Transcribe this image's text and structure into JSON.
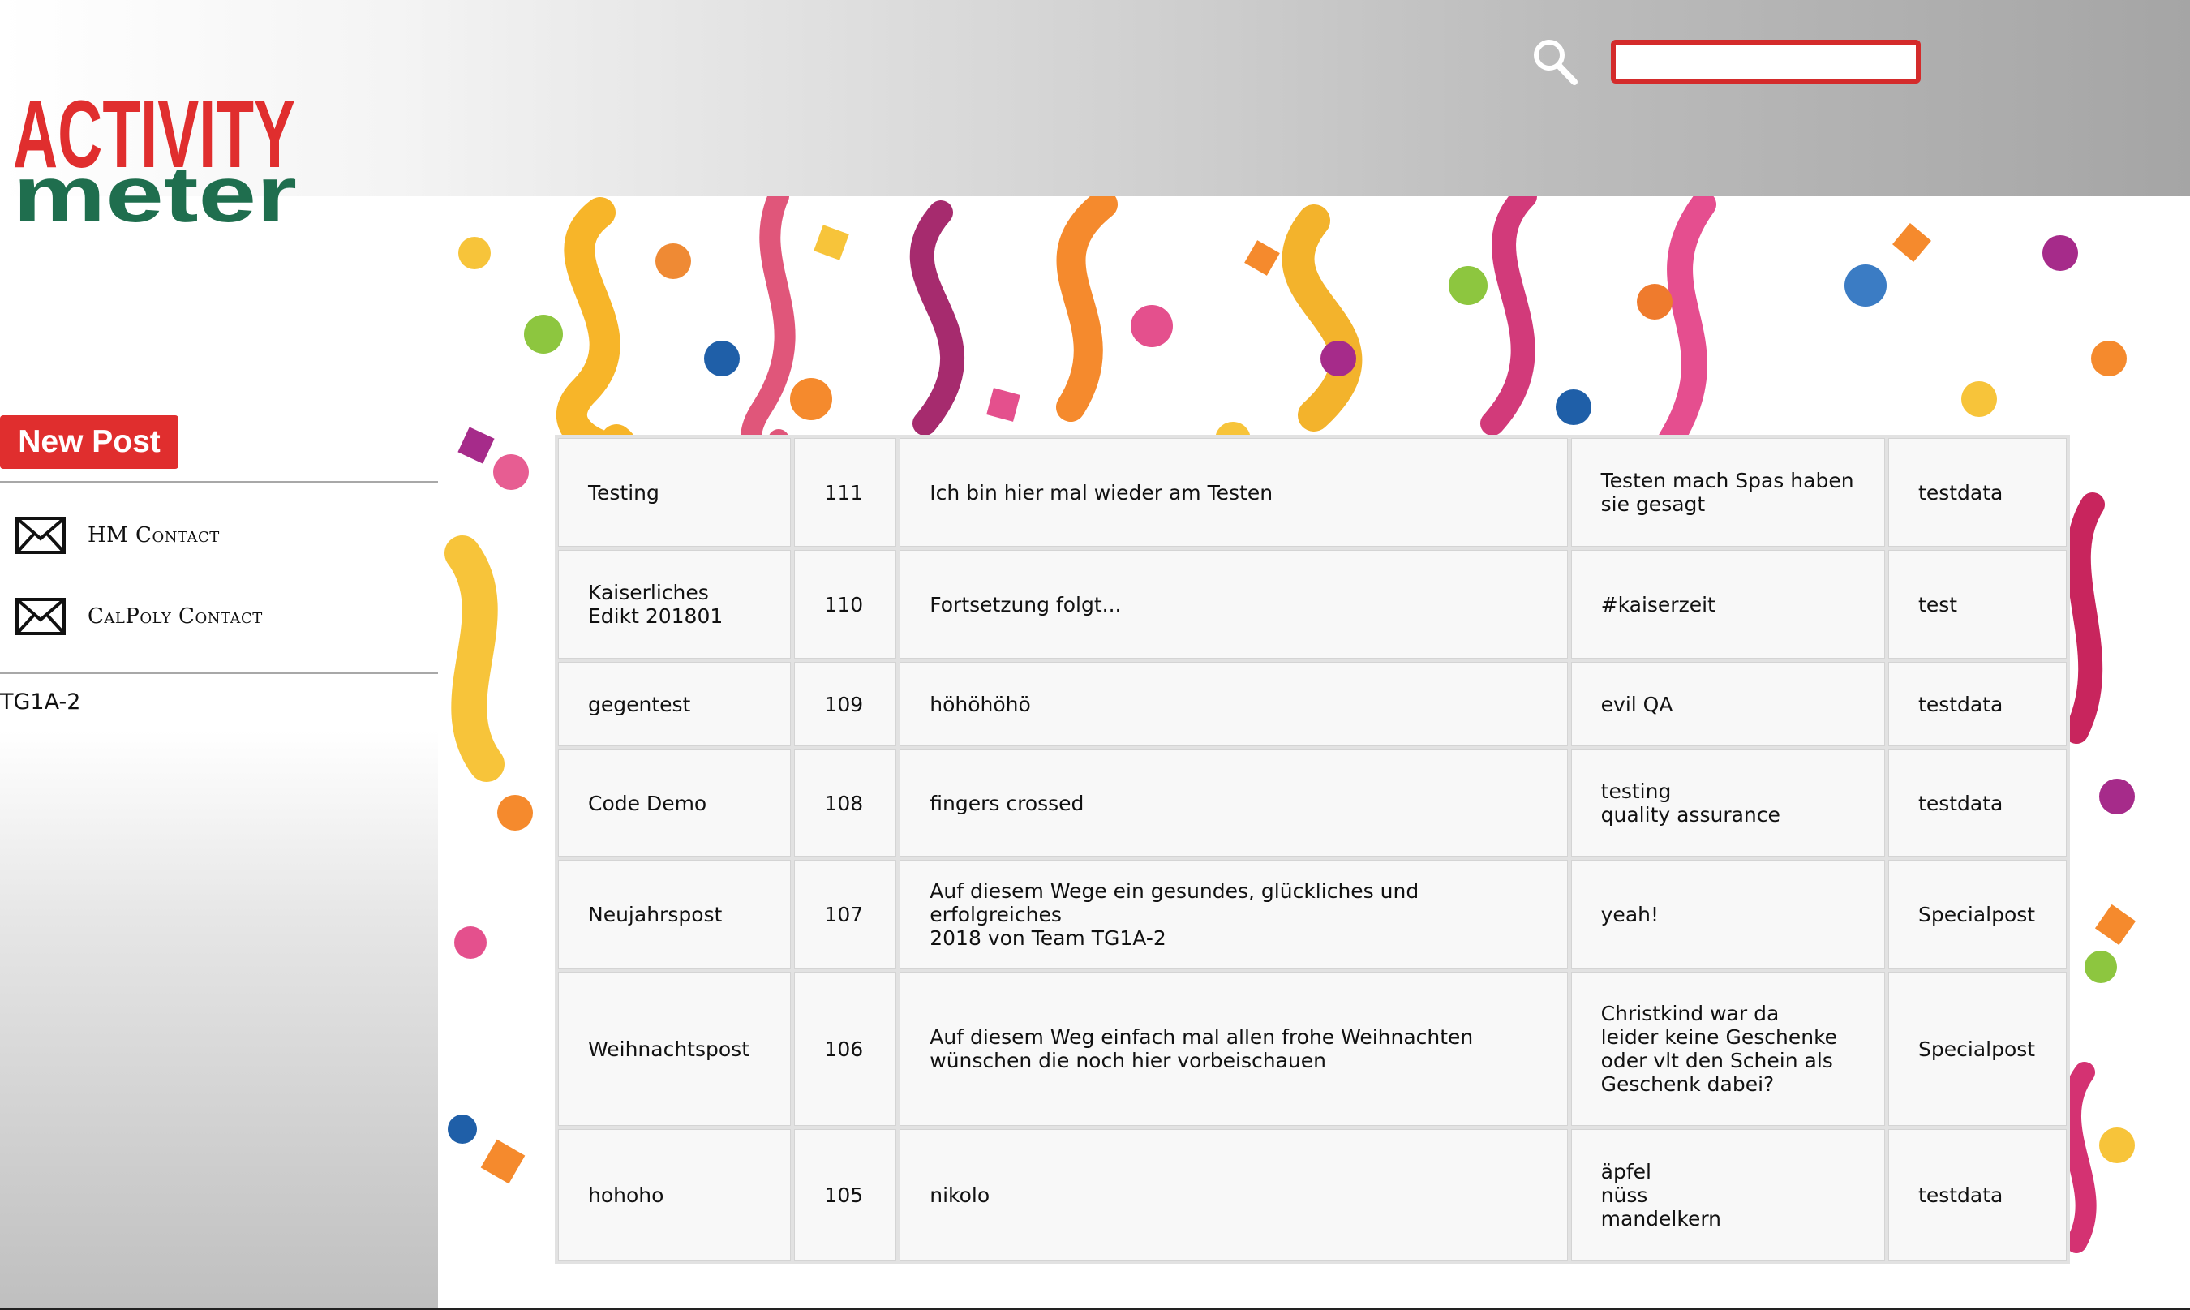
{
  "header": {
    "logo": {
      "line1": "ACTIVITY",
      "line2": "meter"
    },
    "search": {
      "icon": "search-icon",
      "value": "",
      "placeholder": ""
    }
  },
  "sidebar": {
    "new_post_label": "New Post",
    "contacts": [
      {
        "label": "HM Contact",
        "icon": "mail-icon"
      },
      {
        "label": "CalPoly Contact",
        "icon": "mail-icon"
      }
    ],
    "team": "TG1A-2"
  },
  "colors": {
    "accent_red": "#e02e2e",
    "search_border": "#d42b2b",
    "logo_red": "#e02e2e",
    "logo_green": "#1f6e4e"
  },
  "posts": [
    {
      "title": "Testing",
      "id": "111",
      "text": "Ich bin hier mal wieder am Testen",
      "tags": "Testen mach Spas haben\nsie gesagt",
      "category": "testdata"
    },
    {
      "title": "Kaiserliches\nEdikt 201801",
      "id": "110",
      "text": "Fortsetzung folgt...",
      "tags": "#kaiserzeit",
      "category": "test"
    },
    {
      "title": "gegentest",
      "id": "109",
      "text": "höhöhöhö",
      "tags": "evil QA",
      "category": "testdata"
    },
    {
      "title": "Code Demo",
      "id": "108",
      "text": "fingers crossed",
      "tags": "testing\nquality assurance",
      "category": "testdata"
    },
    {
      "title": "Neujahrspost",
      "id": "107",
      "text": "Auf diesem Wege ein gesundes, glückliches und erfolgreiches\n2018 von Team TG1A-2",
      "tags": "yeah!",
      "category": "Specialpost"
    },
    {
      "title": "Weihnachtspost",
      "id": "106",
      "text": "Auf diesem Weg einfach mal allen frohe Weihnachten\nwünschen die noch hier vorbeischauen",
      "tags": "Christkind war da\nleider keine Geschenke\noder vlt den Schein als\nGeschenk dabei?",
      "category": "Specialpost"
    },
    {
      "title": "hohoho",
      "id": "105",
      "text": "nikolo",
      "tags": "äpfel\nnüss\nmandelkern",
      "category": "testdata"
    }
  ]
}
